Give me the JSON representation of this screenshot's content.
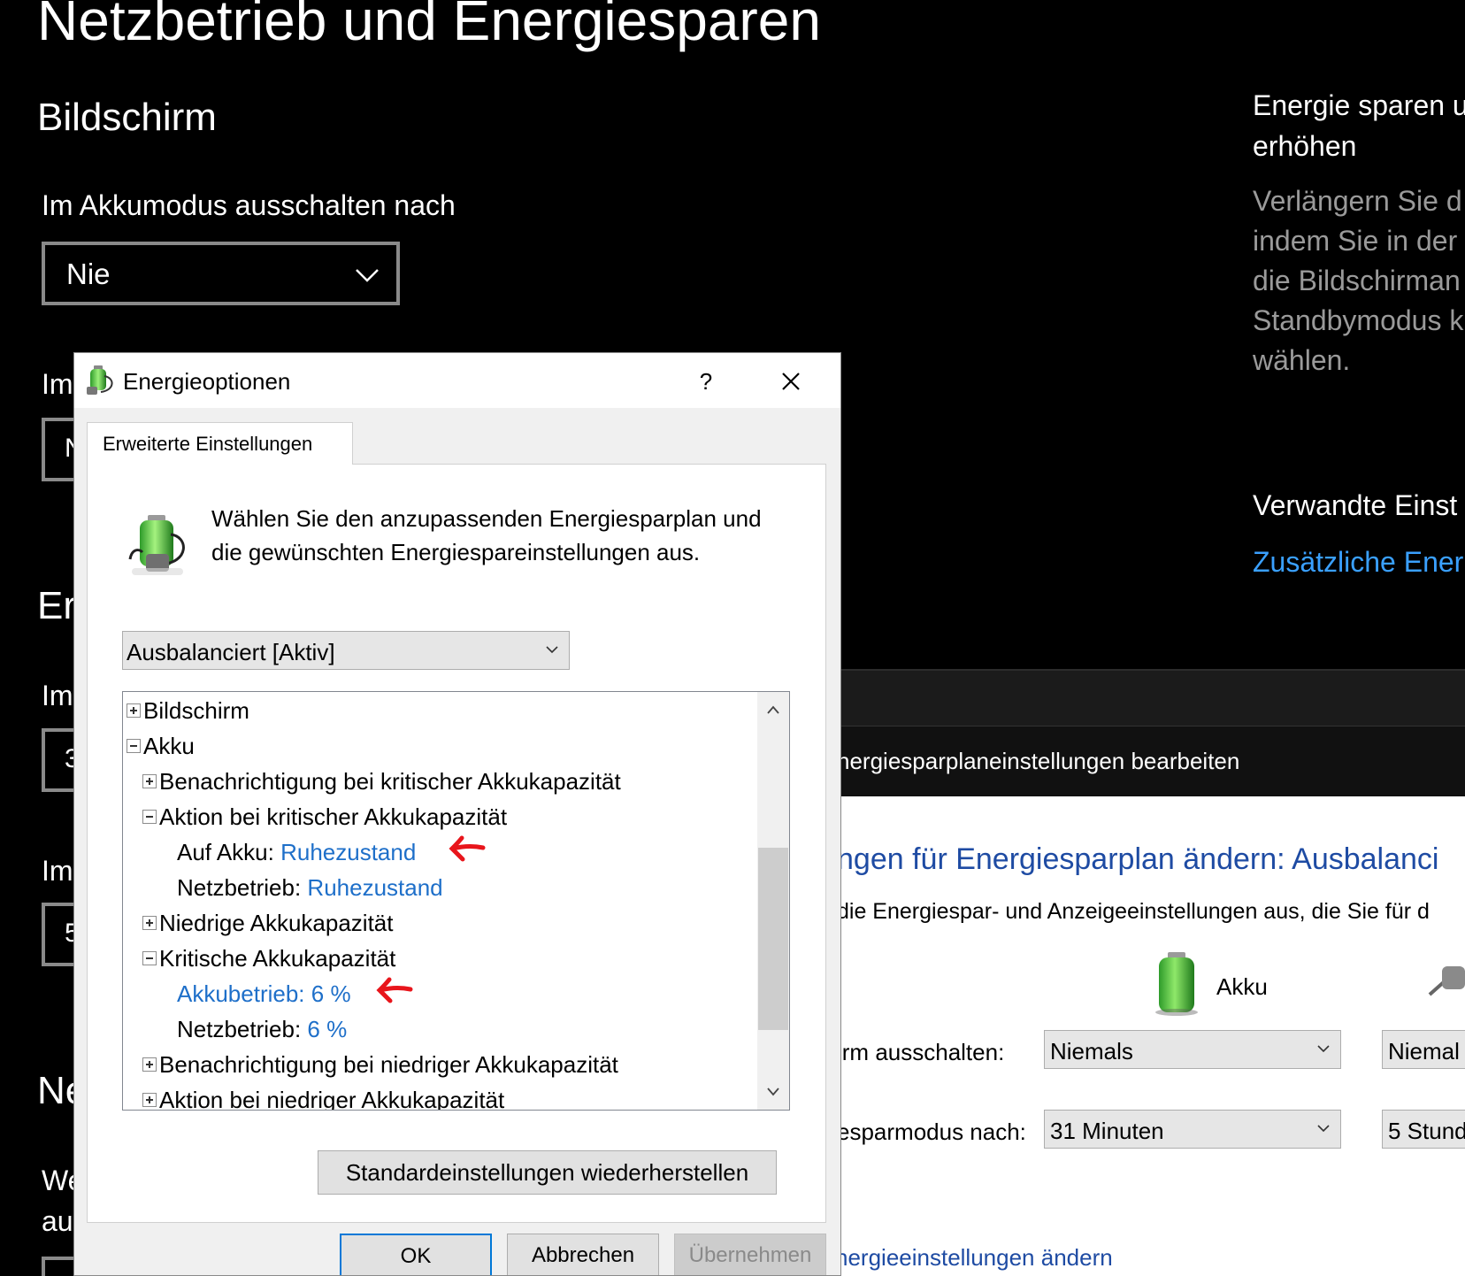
{
  "settings": {
    "title": "Netzbetrieb und Energiesparen",
    "section_bildschirm": "Bildschirm",
    "akku_off_label": "Im Akkumodus ausschalten nach",
    "akku_off_value": "Nie",
    "peek_im_1": "Im",
    "peek_n_1": "N",
    "peek_er": "Er",
    "peek_im_2": "Im",
    "peek_3": "3",
    "peek_im_3": "Im",
    "peek_5": "5",
    "peek_ne": "Ne",
    "peek_we": "We",
    "peek_au": "au"
  },
  "sidebar": {
    "heading_line1": "Energie sparen u",
    "heading_line2": "erhöhen",
    "body_line1": "Verlängern Sie d",
    "body_line2": "indem Sie in der",
    "body_line3": "die Bildschirman",
    "body_line4": "Standbymodus k",
    "body_line5": "wählen.",
    "related_heading": "Verwandte Einst",
    "related_link": "Zusätzliche Ener"
  },
  "bg_window": {
    "toolbar_title": "hergiesparplaneinstellungen bearbeiten",
    "heading": "ngen für Energiesparplan ändern: Ausbalanci",
    "description": "die Energiespar- und Anzeigeeinstellungen aus, die Sie für d",
    "col_akku": "Akku",
    "row1_label": "irm ausschalten:",
    "row1_akku": "Niemals",
    "row1_netz": "Niemal",
    "row2_label": "esparmodus nach:",
    "row2_akku": "31 Minuten",
    "row2_netz": "5 Stund",
    "link": "nergieeinstellungen ändern"
  },
  "dialog": {
    "title": "Energieoptionen",
    "help": "?",
    "tab": "Erweiterte Einstellungen",
    "intro_line1": "Wählen Sie den anzupassenden Energiesparplan und",
    "intro_line2": "die gewünschten Energiespareinstellungen aus.",
    "plan": "Ausbalanciert [Aktiv]",
    "tree": {
      "bildschirm": "Bildschirm",
      "akku": "Akku",
      "notify_critical": "Benachrichtigung bei kritischer Akkukapazität",
      "action_critical": "Aktion bei kritischer Akkukapazität",
      "on_battery_label": "Auf Akku:",
      "on_battery_value": "Ruhezustand",
      "plugged_label": "Netzbetrieb:",
      "plugged_value": "Ruhezustand",
      "low_capacity": "Niedrige Akkukapazität",
      "critical_capacity": "Kritische Akkukapazität",
      "crit_battery_label": "Akkubetrieb:",
      "crit_battery_value": "6 %",
      "crit_plugged_label": "Netzbetrieb:",
      "crit_plugged_value": "6 %",
      "notify_low": "Benachrichtigung bei niedriger Akkukapazität",
      "action_low": "Aktion bei niedriger Akkukapazität"
    },
    "restore_button": "Standardeinstellungen wiederherstellen",
    "ok_button": "OK",
    "cancel_button": "Abbrechen",
    "apply_button": "Übernehmen"
  },
  "colors": {
    "link_blue": "#1e6fc9",
    "dark_link": "#3aa0ff",
    "heading_blue": "#1e4ba3",
    "annotation_red": "#e8151b"
  }
}
